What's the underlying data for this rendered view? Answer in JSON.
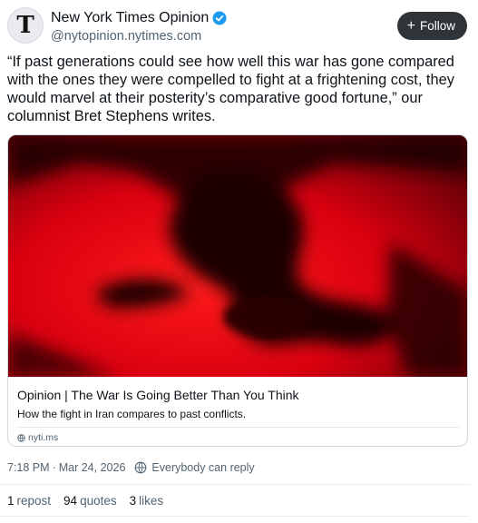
{
  "author": {
    "display_name": "New York Times Opinion",
    "handle": "@nytopinion.nytimes.com",
    "avatar_letter": "T",
    "verified": true,
    "verified_color": "#1d9bf0"
  },
  "follow_button": {
    "label": "Follow",
    "icon": "plus-icon"
  },
  "post": {
    "text": "“If past generations could see how well this war has gone compared with the ones they were compelled to fight at a frightening cost, they would marvel at their posterity’s comparative good fortune,” our columnist Bret Stephens writes.",
    "timestamp": "7:18 PM",
    "date": "Mar 24, 2026",
    "reply_setting": "Everybody can reply"
  },
  "link_card": {
    "title": "Opinion | The War Is Going Better Than You Think",
    "description": "How the fight in Iran compares to past conflicts.",
    "domain": "nyti.ms",
    "image_colors": {
      "red": "#d9000f",
      "shadow": "#1a0003"
    }
  },
  "stats": {
    "reposts": {
      "count": "1",
      "label": "repost"
    },
    "quotes": {
      "count": "94",
      "label": "quotes"
    },
    "likes": {
      "count": "3",
      "label": "likes"
    }
  }
}
